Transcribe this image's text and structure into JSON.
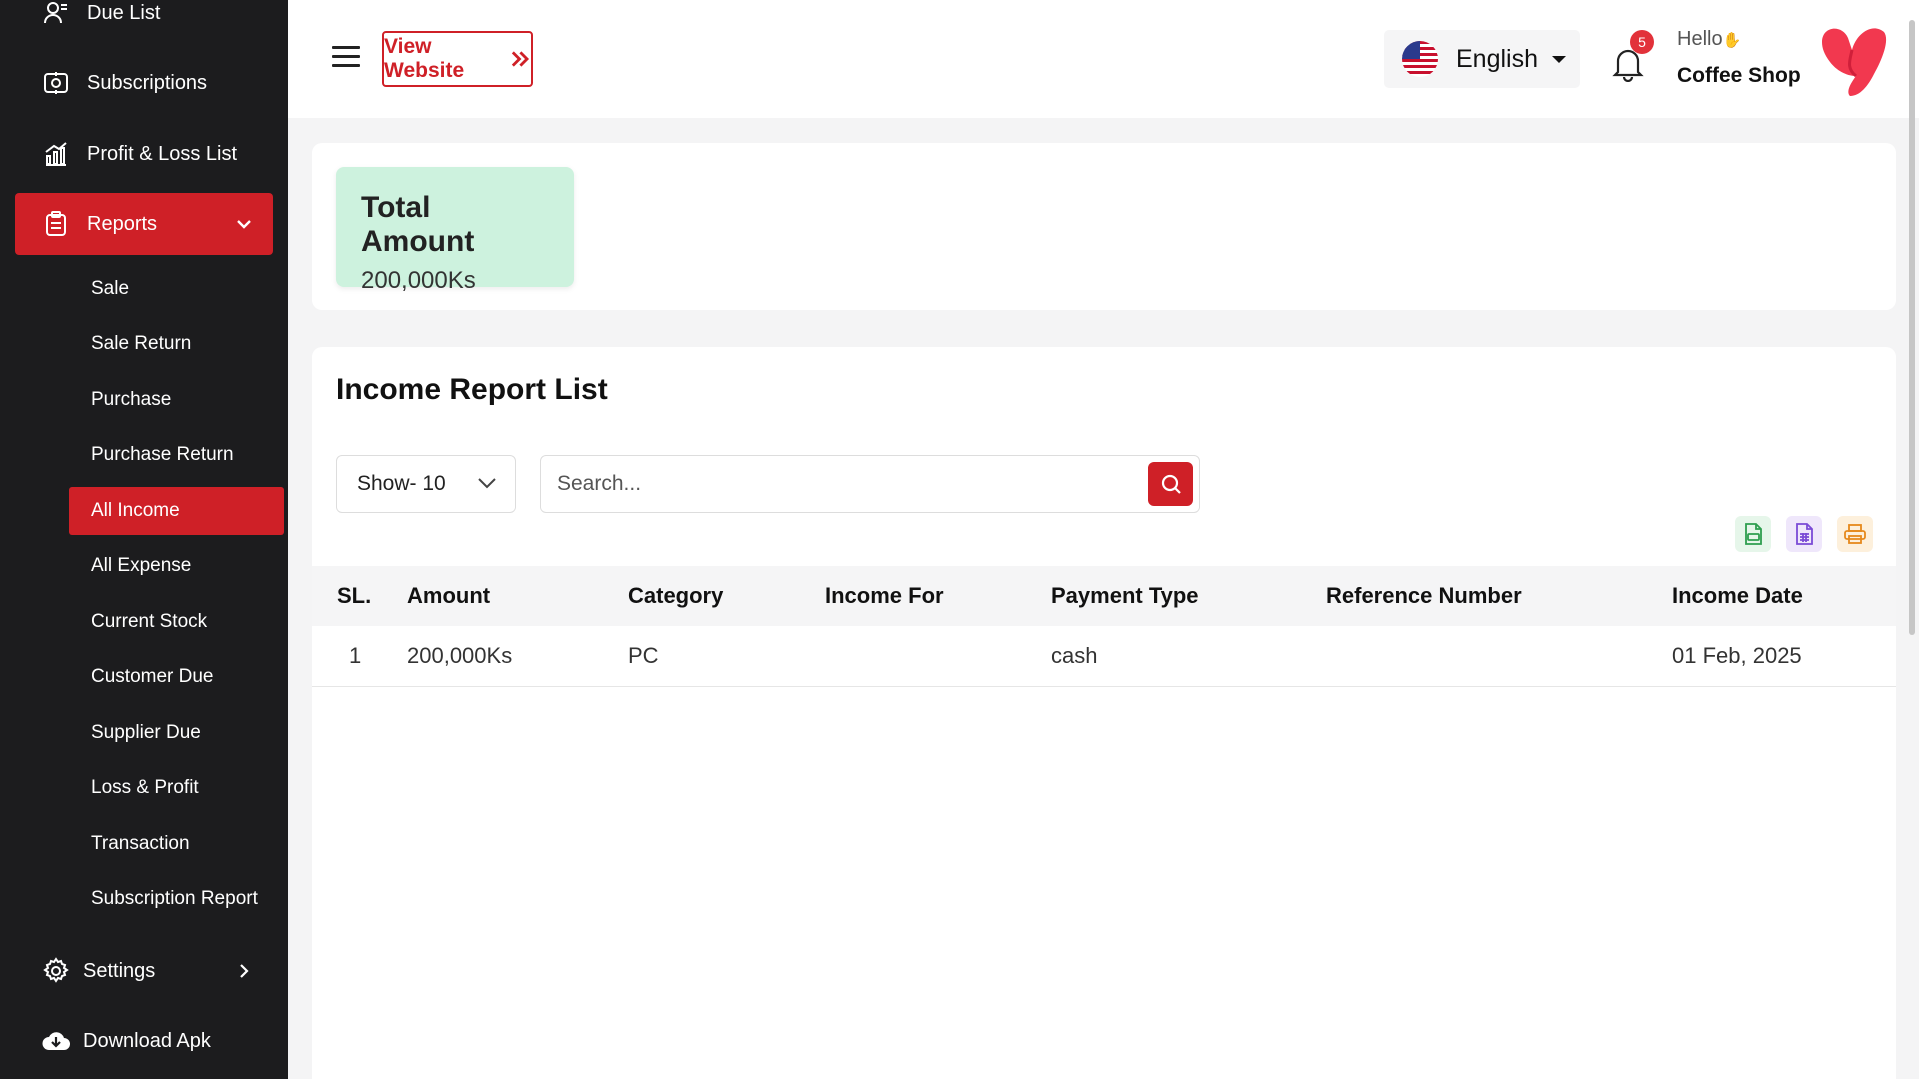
{
  "sidebar": {
    "items": [
      {
        "label": "Due List"
      },
      {
        "label": "Subscriptions"
      },
      {
        "label": "Profit & Loss List"
      },
      {
        "label": "Reports"
      },
      {
        "label": "Settings"
      },
      {
        "label": "Download Apk"
      }
    ],
    "reports_submenu": [
      {
        "label": "Sale"
      },
      {
        "label": "Sale Return"
      },
      {
        "label": "Purchase"
      },
      {
        "label": "Purchase Return"
      },
      {
        "label": "All Income"
      },
      {
        "label": "All Expense"
      },
      {
        "label": "Current Stock"
      },
      {
        "label": "Customer Due"
      },
      {
        "label": "Supplier Due"
      },
      {
        "label": "Loss & Profit"
      },
      {
        "label": "Transaction"
      },
      {
        "label": "Subscription Report"
      }
    ]
  },
  "header": {
    "view_website_label": "View Website",
    "language": "English",
    "notification_count": "5",
    "greeting": "Hello",
    "shop_name": "Coffee Shop"
  },
  "summary": {
    "title": "Total Amount",
    "value": "200,000Ks"
  },
  "report": {
    "title": "Income Report List",
    "show_label": "Show- 10",
    "search_placeholder": "Search...",
    "columns": [
      "SL.",
      "Amount",
      "Category",
      "Income For",
      "Payment Type",
      "Reference Number",
      "Income Date"
    ],
    "rows": [
      {
        "sl": "1",
        "amount": "200,000Ks",
        "category": "PC",
        "income_for": "",
        "payment_type": "cash",
        "reference_number": "",
        "income_date": "01 Feb, 2025"
      }
    ]
  },
  "colors": {
    "accent": "#cf2027",
    "sidebar_bg": "#1c1c1e",
    "summary_card_bg": "#cdf2de"
  }
}
